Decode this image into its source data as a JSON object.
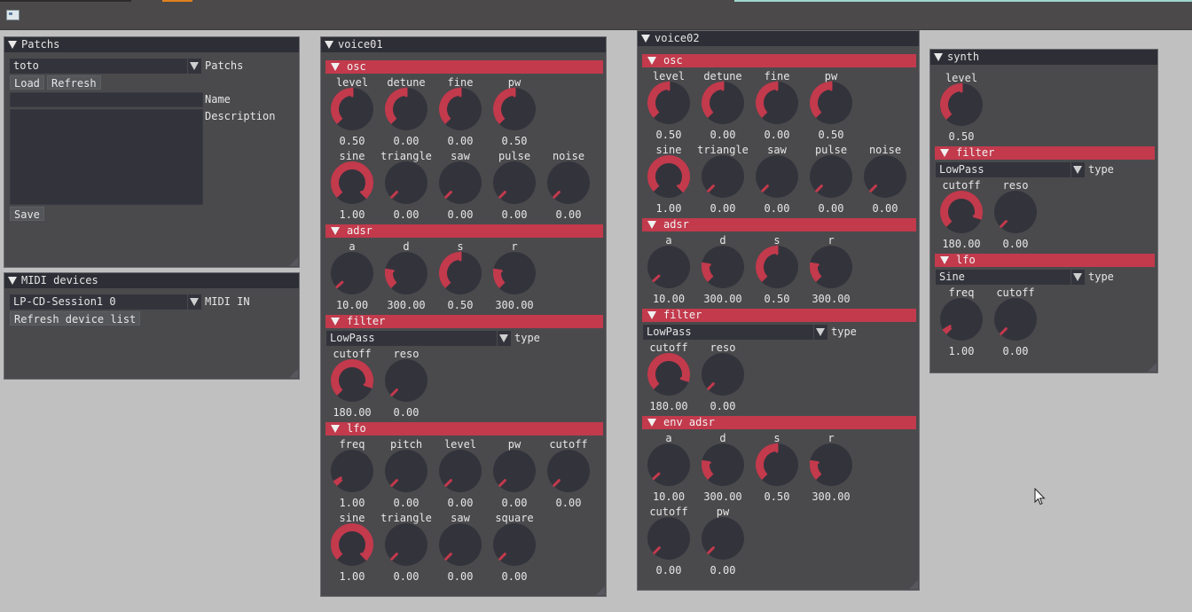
{
  "colors": {
    "accent": "#c23a4c",
    "knob": "#33333c",
    "window": "#4a4a4d",
    "titlebar": "#2e2e36",
    "desktop": "#c0c0c0"
  },
  "patchs": {
    "title": "Patchs",
    "preset": "toto",
    "preset_label": "Patchs",
    "load": "Load",
    "refresh": "Refresh",
    "name_label": "Name",
    "name_value": "",
    "description_label": "Description",
    "description_value": "",
    "save": "Save"
  },
  "midi": {
    "title": "MIDI devices",
    "device": "LP-CD-Session1 0",
    "device_label": "MIDI IN",
    "refresh": "Refresh device list"
  },
  "voice01": {
    "title": "voice01",
    "osc": {
      "title": "osc",
      "knobs": [
        {
          "label": "level",
          "value": "0.50",
          "v": 0.5
        },
        {
          "label": "detune",
          "value": "0.00",
          "v": 0.5
        },
        {
          "label": "fine",
          "value": "0.00",
          "v": 0.5
        },
        {
          "label": "pw",
          "value": "0.50",
          "v": 0.5
        }
      ],
      "mix": [
        {
          "label": "sine",
          "value": "1.00",
          "v": 1
        },
        {
          "label": "triangle",
          "value": "0.00",
          "v": 0
        },
        {
          "label": "saw",
          "value": "0.00",
          "v": 0
        },
        {
          "label": "pulse",
          "value": "0.00",
          "v": 0
        },
        {
          "label": "noise",
          "value": "0.00",
          "v": 0
        }
      ]
    },
    "adsr": {
      "title": "adsr",
      "knobs": [
        {
          "label": "a",
          "value": "10.00",
          "v": 0.01
        },
        {
          "label": "d",
          "value": "300.00",
          "v": 0.2
        },
        {
          "label": "s",
          "value": "0.50",
          "v": 0.5
        },
        {
          "label": "r",
          "value": "300.00",
          "v": 0.2
        }
      ]
    },
    "filter": {
      "title": "filter",
      "type": "LowPass",
      "type_label": "type",
      "knobs": [
        {
          "label": "cutoff",
          "value": "180.00",
          "v": 0.9
        },
        {
          "label": "reso",
          "value": "0.00",
          "v": 0
        }
      ]
    },
    "lfo": {
      "title": "lfo",
      "knobs": [
        {
          "label": "freq",
          "value": "1.00",
          "v": 0.05
        },
        {
          "label": "pitch",
          "value": "0.00",
          "v": 0
        },
        {
          "label": "level",
          "value": "0.00",
          "v": 0
        },
        {
          "label": "pw",
          "value": "0.00",
          "v": 0
        },
        {
          "label": "cutoff",
          "value": "0.00",
          "v": 0
        }
      ],
      "waves": [
        {
          "label": "sine",
          "value": "1.00",
          "v": 1
        },
        {
          "label": "triangle",
          "value": "0.00",
          "v": 0
        },
        {
          "label": "saw",
          "value": "0.00",
          "v": 0
        },
        {
          "label": "square",
          "value": "0.00",
          "v": 0
        }
      ]
    }
  },
  "voice02": {
    "title": "voice02",
    "osc": {
      "title": "osc",
      "knobs": [
        {
          "label": "level",
          "value": "0.50",
          "v": 0.5
        },
        {
          "label": "detune",
          "value": "0.00",
          "v": 0.5
        },
        {
          "label": "fine",
          "value": "0.00",
          "v": 0.5
        },
        {
          "label": "pw",
          "value": "0.50",
          "v": 0.5
        }
      ],
      "mix": [
        {
          "label": "sine",
          "value": "1.00",
          "v": 1
        },
        {
          "label": "triangle",
          "value": "0.00",
          "v": 0
        },
        {
          "label": "saw",
          "value": "0.00",
          "v": 0
        },
        {
          "label": "pulse",
          "value": "0.00",
          "v": 0
        },
        {
          "label": "noise",
          "value": "0.00",
          "v": 0
        }
      ]
    },
    "adsr": {
      "title": "adsr",
      "knobs": [
        {
          "label": "a",
          "value": "10.00",
          "v": 0.01
        },
        {
          "label": "d",
          "value": "300.00",
          "v": 0.2
        },
        {
          "label": "s",
          "value": "0.50",
          "v": 0.5
        },
        {
          "label": "r",
          "value": "300.00",
          "v": 0.2
        }
      ]
    },
    "filter": {
      "title": "filter",
      "type": "LowPass",
      "type_label": "type",
      "knobs": [
        {
          "label": "cutoff",
          "value": "180.00",
          "v": 0.9
        },
        {
          "label": "reso",
          "value": "0.00",
          "v": 0
        }
      ]
    },
    "env": {
      "title": "env adsr",
      "knobs": [
        {
          "label": "a",
          "value": "10.00",
          "v": 0.01
        },
        {
          "label": "d",
          "value": "300.00",
          "v": 0.2
        },
        {
          "label": "s",
          "value": "0.50",
          "v": 0.5
        },
        {
          "label": "r",
          "value": "300.00",
          "v": 0.2
        }
      ],
      "mods": [
        {
          "label": "cutoff",
          "value": "0.00",
          "v": 0
        },
        {
          "label": "pw",
          "value": "0.00",
          "v": 0
        }
      ]
    }
  },
  "synth": {
    "title": "synth",
    "knobs": [
      {
        "label": "level",
        "value": "0.50",
        "v": 0.5
      }
    ],
    "filter": {
      "title": "filter",
      "type": "LowPass",
      "type_label": "type",
      "knobs": [
        {
          "label": "cutoff",
          "value": "180.00",
          "v": 0.9
        },
        {
          "label": "reso",
          "value": "0.00",
          "v": 0
        }
      ]
    },
    "lfo": {
      "title": "lfo",
      "type": "Sine",
      "type_label": "type",
      "knobs": [
        {
          "label": "freq",
          "value": "1.00",
          "v": 0.05
        },
        {
          "label": "cutoff",
          "value": "0.00",
          "v": 0
        }
      ]
    }
  }
}
